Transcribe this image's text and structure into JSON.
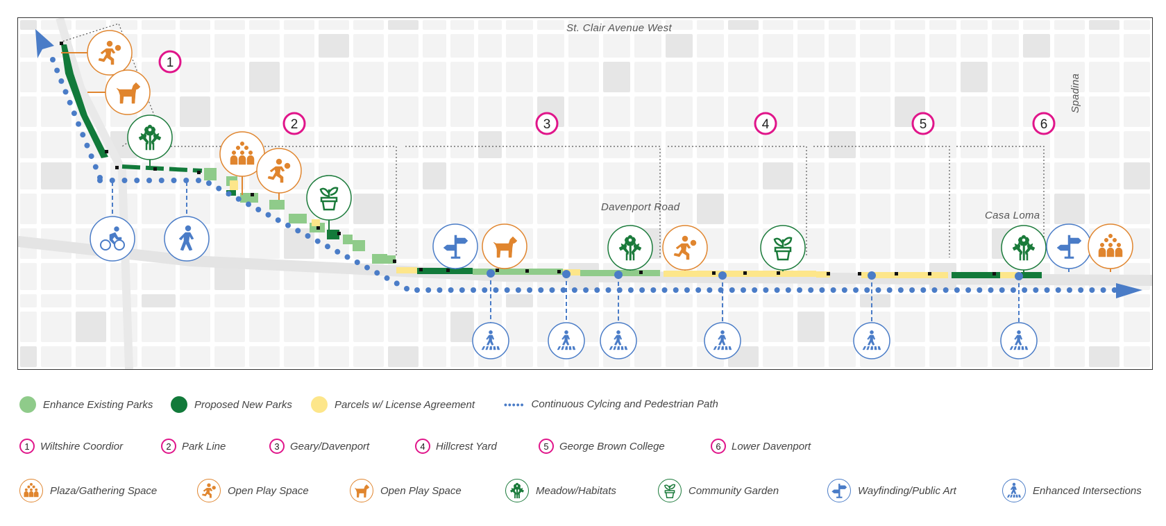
{
  "colors": {
    "enhance_existing": "#8fcb8a",
    "proposed_new": "#127a3a",
    "license_parcels": "#fde68a",
    "path_blue": "#4a7cc7",
    "district_magenta": "#e0158a",
    "orange": "#e0852e",
    "green_icon": "#1a7a3a",
    "blue_icon": "#4a7cc7"
  },
  "map": {
    "street_labels": {
      "st_clair": "St. Clair Avenue West",
      "davenport": "Davenport Road",
      "casa_loma": "Casa Loma",
      "spadina": "Spadina"
    },
    "districts": [
      "1",
      "2",
      "3",
      "4",
      "5",
      "6"
    ]
  },
  "legend": {
    "park_types": [
      {
        "label": "Enhance Existing Parks",
        "color_key": "enhance_existing"
      },
      {
        "label": "Proposed New Parks",
        "color_key": "proposed_new"
      },
      {
        "label": "Parcels w/ License Agreement",
        "color_key": "license_parcels"
      },
      {
        "label": "Continuous Cylcing and Pedestrian Path",
        "symbol": "•••••"
      }
    ],
    "districts": [
      {
        "num": "1",
        "label": "Wiltshire Coordior"
      },
      {
        "num": "2",
        "label": "Park Line"
      },
      {
        "num": "3",
        "label": "Geary/Davenport"
      },
      {
        "num": "4",
        "label": "Hillcrest Yard"
      },
      {
        "num": "5",
        "label": "George Brown College"
      },
      {
        "num": "6",
        "label": "Lower Davenport"
      }
    ],
    "amenities": [
      {
        "icon": "plaza-gathering-icon",
        "label": "Plaza/Gathering Space"
      },
      {
        "icon": "open-play-runner-icon",
        "label": "Open Play Space"
      },
      {
        "icon": "open-play-dog-icon",
        "label": "Open Play Space"
      },
      {
        "icon": "meadow-habitat-icon",
        "label": "Meadow/Habitats"
      },
      {
        "icon": "community-garden-icon",
        "label": "Community Garden"
      },
      {
        "icon": "wayfinding-icon",
        "label": "Wayfinding/Public Art"
      },
      {
        "icon": "enhanced-intersection-icon",
        "label": "Enhanced Intersections"
      }
    ]
  }
}
